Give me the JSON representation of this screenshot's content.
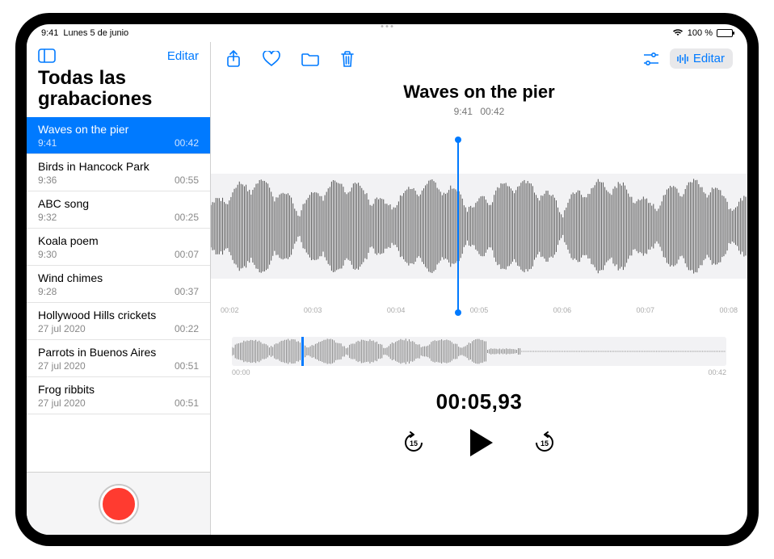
{
  "status": {
    "time": "9:41",
    "date": "Lunes 5 de junio",
    "battery": "100 %"
  },
  "sidebar": {
    "edit_label": "Editar",
    "title": "Todas las grabaciones",
    "recordings": [
      {
        "title": "Waves on the pier",
        "time": "9:41",
        "duration": "00:42",
        "selected": true
      },
      {
        "title": "Birds in Hancock Park",
        "time": "9:36",
        "duration": "00:55"
      },
      {
        "title": "ABC song",
        "time": "9:32",
        "duration": "00:25"
      },
      {
        "title": "Koala poem",
        "time": "9:30",
        "duration": "00:07"
      },
      {
        "title": "Wind chimes",
        "time": "9:28",
        "duration": "00:37"
      },
      {
        "title": "Hollywood Hills crickets",
        "time": "27 jul 2020",
        "duration": "00:22"
      },
      {
        "title": "Parrots in Buenos Aires",
        "time": "27 jul 2020",
        "duration": "00:51"
      },
      {
        "title": "Frog ribbits",
        "time": "27 jul 2020",
        "duration": "00:51"
      }
    ]
  },
  "detail": {
    "toolbar": {
      "edit_label": "Editar"
    },
    "title": "Waves on the pier",
    "sub_time": "9:41",
    "sub_duration": "00:42",
    "ruler_ticks": [
      "00:02",
      "00:03",
      "00:04",
      "00:05",
      "00:06",
      "00:07",
      "00:08"
    ],
    "overview_start": "00:00",
    "overview_end": "00:42",
    "playhead_percent": 46,
    "overview_playhead_percent": 14,
    "big_time": "00:05,93",
    "skip_amount": "15"
  },
  "colors": {
    "accent": "#007aff",
    "record": "#ff3b30"
  }
}
